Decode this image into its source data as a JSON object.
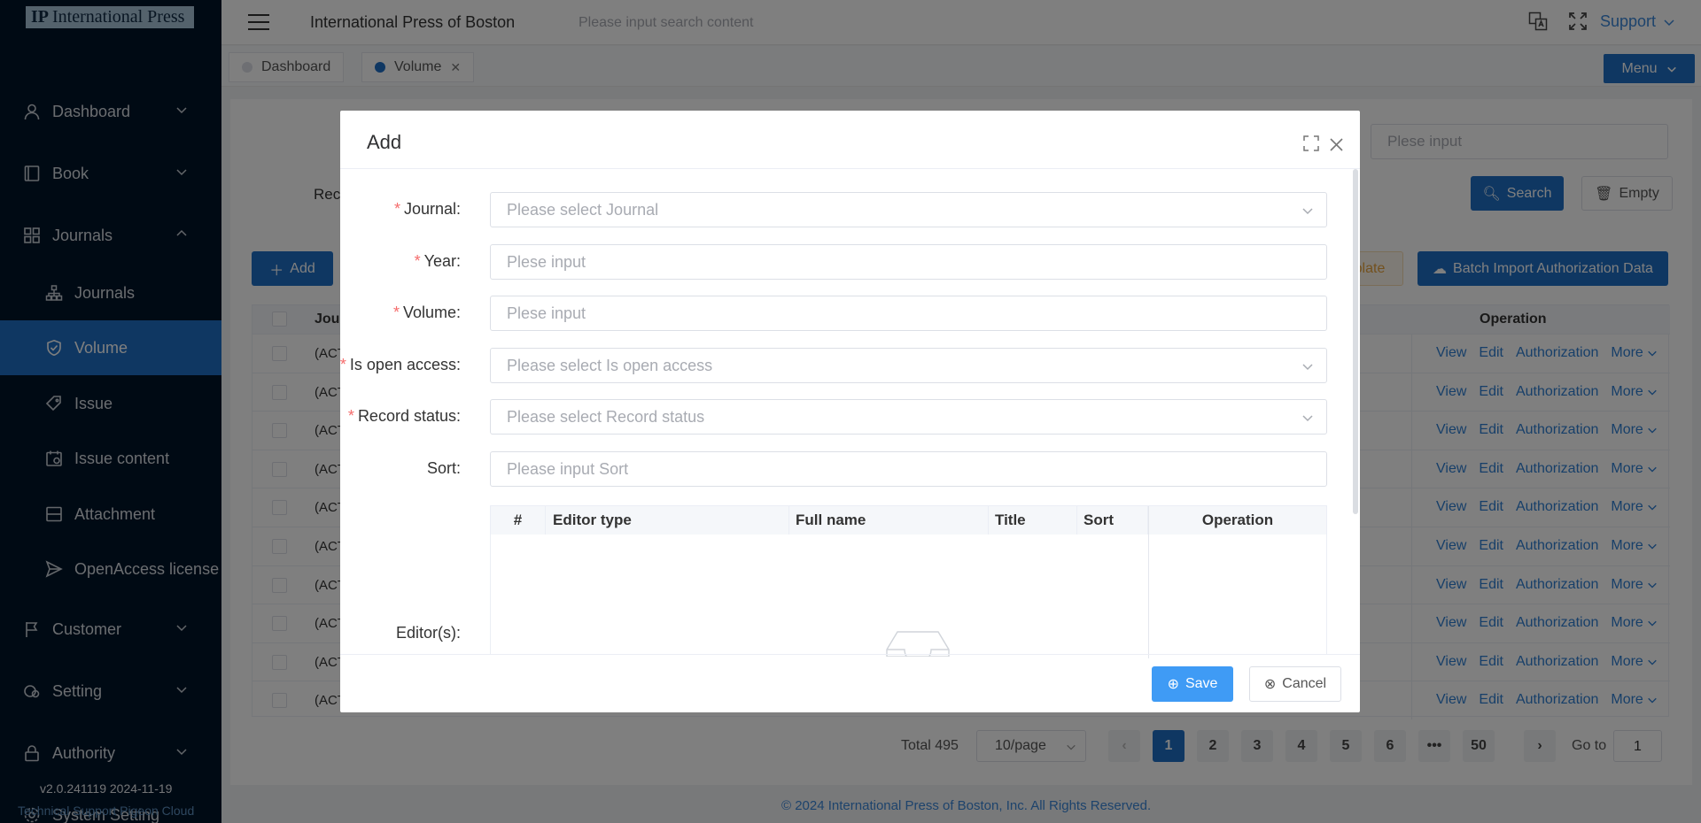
{
  "brand": {
    "logo_mark": "IP",
    "name": "International Press"
  },
  "sidebar": {
    "items": [
      {
        "label": "Dashboard",
        "icon": "user-icon"
      },
      {
        "label": "Book",
        "icon": "book-icon"
      },
      {
        "label": "Journals",
        "icon": "grid-icon",
        "expanded": true
      },
      {
        "label": "Journals",
        "icon": "sitemap-icon",
        "sub": true
      },
      {
        "label": "Volume",
        "icon": "shield-check-icon",
        "sub": true,
        "active": true
      },
      {
        "label": "Issue",
        "icon": "tag-icon",
        "sub": true
      },
      {
        "label": "Issue content",
        "icon": "calendar-icon",
        "sub": true
      },
      {
        "label": "Attachment",
        "icon": "attachment-icon",
        "sub": true
      },
      {
        "label": "OpenAccess license",
        "icon": "send-icon",
        "sub": true
      },
      {
        "label": "Customer",
        "icon": "flag-icon"
      },
      {
        "label": "Setting",
        "icon": "setting-icon"
      },
      {
        "label": "Authority",
        "icon": "lock-icon"
      },
      {
        "label": "System Setting",
        "icon": "gear-icon"
      }
    ],
    "version": "v2.0.241119 2024-11-19",
    "support": "Technical Support Pigeon Cloud"
  },
  "topbar": {
    "title": "International Press of Boston",
    "search_placeholder": "Please input search content",
    "support": "Support"
  },
  "tabs": [
    {
      "label": "Dashboard",
      "active": false
    },
    {
      "label": "Volume",
      "active": true,
      "closable": true
    }
  ],
  "menu_button": "Menu",
  "filter": {
    "input_placeholder": "Plese input",
    "search": "Search",
    "empty": "Empty",
    "record_label": "Rec"
  },
  "actions": {
    "add": "Add",
    "template": "plate",
    "batch_import": "Batch Import Authorization Data"
  },
  "table": {
    "col_journal": "Jour",
    "col_operation": "Operation",
    "rows_prefix": [
      "(ACT",
      "(ACT",
      "(ACT",
      "(ACT",
      "(ACT",
      "(ACT",
      "(ACT",
      "(ACT",
      "(ACT",
      "(ACT"
    ],
    "ops": {
      "view": "View",
      "edit": "Edit",
      "authorization": "Authorization",
      "more": "More"
    }
  },
  "pagination": {
    "total": "Total 495",
    "page_size": "10/page",
    "pages": [
      "1",
      "2",
      "3",
      "4",
      "5",
      "6",
      "•••",
      "50"
    ],
    "current": "1",
    "goto_label": "Go to",
    "goto_value": "1"
  },
  "footer": "© 2024 International Press of Boston, Inc. All Rights Reserved.",
  "modal": {
    "title": "Add",
    "fields": [
      {
        "label": "Journal:",
        "required": true,
        "placeholder": "Please select Journal",
        "select": true
      },
      {
        "label": "Year:",
        "required": true,
        "placeholder": "Plese input",
        "select": false
      },
      {
        "label": "Volume:",
        "required": true,
        "placeholder": "Plese input",
        "select": false
      },
      {
        "label": "Is open access:",
        "required": true,
        "placeholder": "Please select Is open access",
        "select": true
      },
      {
        "label": "Record status:",
        "required": true,
        "placeholder": "Please select Record status",
        "select": true
      },
      {
        "label": "Sort:",
        "required": false,
        "placeholder": "Please input Sort",
        "select": false
      }
    ],
    "editors_label": "Editor(s):",
    "editor_columns": [
      "#",
      "Editor type",
      "Full name",
      "Title",
      "Sort",
      "Operation"
    ],
    "save": "Save",
    "cancel": "Cancel"
  },
  "colors": {
    "sidebar_bg": "#001529",
    "accent": "#1f6fc5",
    "required": "#f56c6c",
    "link": "#2f7fd3"
  }
}
